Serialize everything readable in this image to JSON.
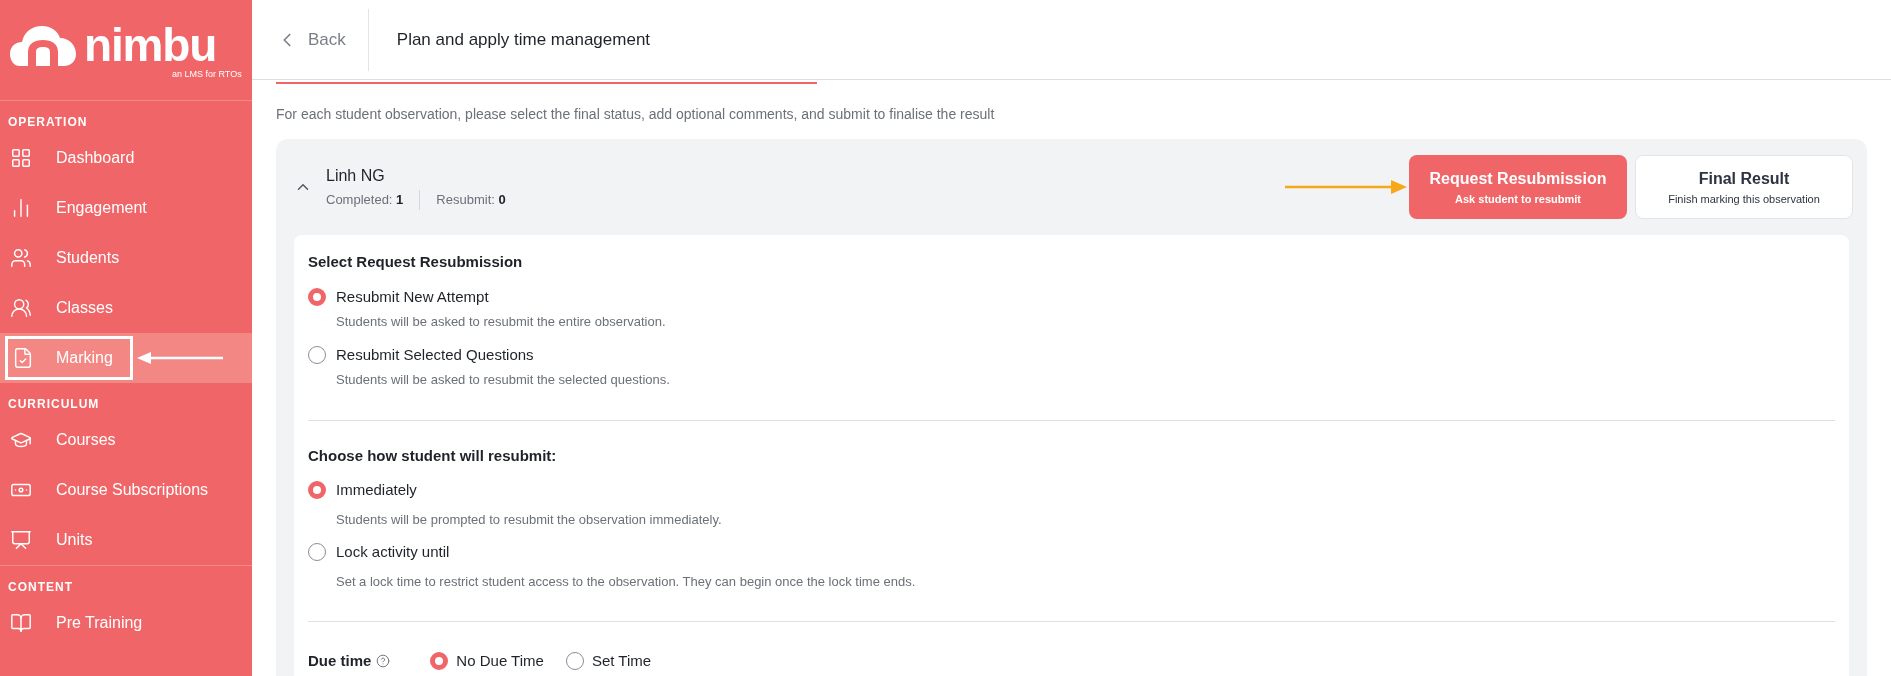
{
  "logo": {
    "name": "nimbu",
    "tagline": "an LMS for RTOs"
  },
  "sidebar": {
    "sections": [
      {
        "title": "OPERATION",
        "items": [
          {
            "label": "Dashboard",
            "selected": false,
            "annotated": false
          },
          {
            "label": "Engagement",
            "selected": false,
            "annotated": false
          },
          {
            "label": "Students",
            "selected": false,
            "annotated": false
          },
          {
            "label": "Classes",
            "selected": false,
            "annotated": false
          },
          {
            "label": "Marking",
            "selected": true,
            "annotated": true
          }
        ]
      },
      {
        "title": "CURRICULUM",
        "items": [
          {
            "label": "Courses",
            "selected": false,
            "annotated": false
          },
          {
            "label": "Course Subscriptions",
            "selected": false,
            "annotated": false
          },
          {
            "label": "Units",
            "selected": false,
            "annotated": false
          }
        ]
      },
      {
        "title": "CONTENT",
        "items": [
          {
            "label": "Pre Training",
            "selected": false,
            "annotated": false
          }
        ]
      }
    ]
  },
  "header": {
    "back": "Back",
    "title": "Plan and apply time management"
  },
  "progress": {
    "level": 0.34
  },
  "instructions": "For each student observation, please select the final status, add optional comments, and submit to finalise the result",
  "student": {
    "name": "Linh NG",
    "expanded": true,
    "stats": [
      {
        "label": "Completed:",
        "value": "1"
      },
      {
        "label": "Resubmit:",
        "value": "0"
      }
    ]
  },
  "result_options": [
    {
      "title": "Request Resubmission",
      "subtitle": "Ask student to resubmit",
      "selected": true,
      "annotated": true
    },
    {
      "title": "Final Result",
      "subtitle": "Finish marking this observation",
      "selected": false,
      "annotated": false
    }
  ],
  "groups": [
    {
      "heading": "Select Request Resubmission",
      "options": [
        {
          "label": "Resubmit New Attempt",
          "description": "Students will be asked to resubmit the entire observation.",
          "selected": true
        },
        {
          "label": "Resubmit Selected Questions",
          "description": "Students will be asked to resubmit the selected questions.",
          "selected": false
        }
      ]
    },
    {
      "heading": "Choose how student will resubmit:",
      "options": [
        {
          "label": "Immediately",
          "description": "Students will be prompted to resubmit the observation immediately.",
          "selected": true
        },
        {
          "label": "Lock activity until",
          "description": "Set a lock time to restrict student access to the observation. They can begin once the lock time ends.",
          "selected": false
        }
      ]
    }
  ],
  "due_time": {
    "label": "Due time",
    "options": [
      {
        "label": "No Due Time",
        "selected": true
      },
      {
        "label": "Set Time",
        "selected": false
      }
    ]
  }
}
